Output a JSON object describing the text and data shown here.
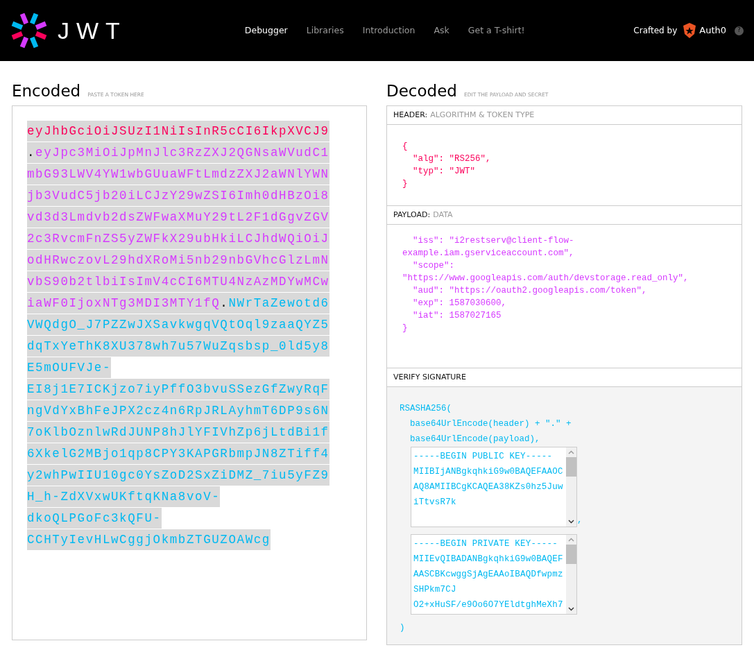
{
  "navbar": {
    "logo_text": "JWT",
    "links": [
      {
        "label": "Debugger",
        "selected": true
      },
      {
        "label": "Libraries",
        "selected": false
      },
      {
        "label": "Introduction",
        "selected": false
      },
      {
        "label": "Ask",
        "selected": false
      },
      {
        "label": "Get a T-shirt!",
        "selected": false
      }
    ],
    "crafted_by": "Crafted by",
    "brand": "Auth0",
    "help": "?"
  },
  "encoded": {
    "title": "Encoded",
    "hint": "PASTE A TOKEN HERE",
    "token": {
      "header": "eyJhbGciOiJSUzI1NiIsInR5cCI6IkpXVCJ9",
      "payload": "eyJpc3MiOiJpMnJlc3RzZXJ2QGNsaWVudC1mbG93LWV4YW1wbGUuaWFtLmdzZXJ2aWNlYWNjb3VudC5jb20iLCJzY29wZSI6Imh0dHBzOi8vd3d3Lmdvb2dsZWFwaXMuY29tL2F1dGgvZGV2c3RvcmFnZS5yZWFkX29ubHkiLCJhdWQiOiJodHRwczovL29hdXRoMi5nb29nbGVhcGlzLmNvbS90b2tlbiIsImV4cCI6MTU4NzAzMDYwMCwiaWF0IjoxNTg3MDI3MTY1fQ",
      "signature": "NWrTaZewotd6VWQdgO_J7PZZwJXSavkwgqVQtOql9zaaQYZ5dqTxYeThK8XU378wh7u57WuZqsbsp_0ld5y8E5mOUFVJe-EI8j1E7ICKjzo7iyPffO3bvuSSezGfZwyRqFngVdYxBhFeJPX2cz4n6RpJRLAyhmT6DP9s6N7oKlbOznlwRdJUNP8hJlYFIVhZp6jLtdBi1f6XkelG2MBjo1qp8CPY3KAPGRbmpJN8ZTiff4y2whPwIIU10gc0YsZoD2SxZiDMZ_7iu5yFZ9H_h-ZdXVxwUKftqKNa8voV-dkoQLPGoFc3kQFU-CCHTyIevHLwCggjOkmbZTGUZOAWcg"
    },
    "separators": [
      ".",
      "."
    ]
  },
  "decoded": {
    "title": "Decoded",
    "hint": "EDIT THE PAYLOAD AND SECRET",
    "sections": [
      {
        "kind": "header",
        "label": "HEADER:",
        "sublabel": "ALGORITHM & TOKEN TYPE",
        "lines": [
          "{",
          "  \"alg\": \"RS256\",",
          "  \"typ\": \"JWT\"",
          "}"
        ]
      },
      {
        "kind": "payload",
        "label": "PAYLOAD:",
        "sublabel": "DATA",
        "lines": [
          "  \"iss\": \"i2restserv@client-flow-",
          "example.iam.gserviceaccount.com\",",
          "  \"scope\":",
          "\"https://www.googleapis.com/auth/devstorage.read_only\",",
          "  \"aud\": \"https://oauth2.googleapis.com/token\",",
          "  \"exp\": 1587030600,",
          "  \"iat\": 1587027165",
          "}"
        ]
      },
      {
        "kind": "signature",
        "label": "VERIFY SIGNATURE",
        "lines": [
          "RSASHA256(",
          "  base64UrlEncode(header) + \".\" +",
          "  base64UrlEncode(payload),"
        ],
        "keys": [
          {
            "lines": [
              "-----BEGIN PUBLIC KEY-----",
              "MIIBIjANBgkqhkiG9w0BAQEFAAOC",
              "AQ8AMIIBCgKCAQEA38KZs0hz5Juw",
              "iTtvsR7k"
            ]
          },
          {
            "lines": [
              "-----BEGIN PRIVATE KEY-----",
              "MIIEvQIBADANBgkqhkiG9w0BAQEF",
              "AASCBKcwggSjAgEAAoIBAQDfwpmz",
              "SHPkm7CJ",
              "O2+xHuSF/e9Oo6O7YEldtghMeXh7"
            ]
          }
        ],
        "key_separator": ",",
        "closing": ")"
      }
    ]
  }
}
